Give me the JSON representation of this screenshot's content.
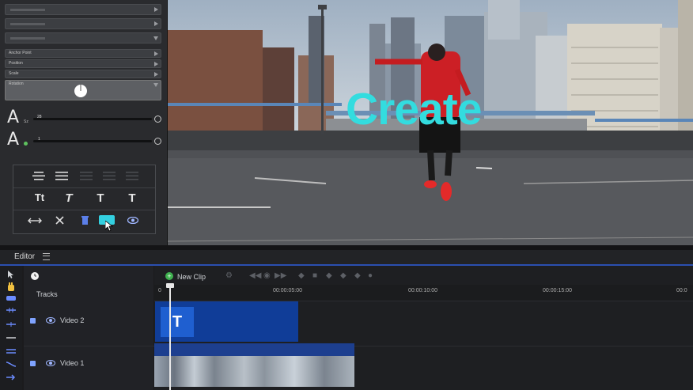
{
  "inspector": {
    "props": [
      {
        "label": "Anchor Point"
      },
      {
        "label": "Position"
      },
      {
        "label": "Scale"
      },
      {
        "label": "Rotation"
      }
    ],
    "font_size_glyph": "A",
    "font_size_sub": "Sz",
    "font_size_value": "28",
    "spacing_glyph": "A",
    "spacing_value": "1"
  },
  "format": {
    "row2": [
      "Tt",
      "T",
      "T",
      "T"
    ]
  },
  "preview": {
    "caption": "Create",
    "caption_color": "#33dcdf"
  },
  "editor": {
    "tab": "Editor",
    "new_clip": "New Clip",
    "tracks_label": "Tracks",
    "ruler": [
      "0",
      "00:00:05:00",
      "00:00:10:00",
      "00:00:15:00",
      "00:0"
    ],
    "tracks": [
      {
        "name": "Video 2"
      },
      {
        "name": "Video 1"
      }
    ],
    "text_clip_glyph": "T",
    "accent": "#2b4fb0"
  }
}
